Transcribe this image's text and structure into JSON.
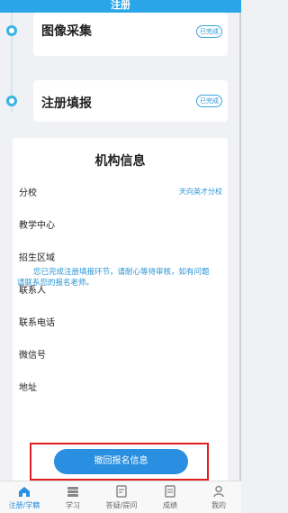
{
  "header": {
    "title": "注册"
  },
  "steps": [
    {
      "title": "图像采集",
      "status": "已完成"
    },
    {
      "title": "注册填报",
      "status": "已完成"
    }
  ],
  "info": {
    "title": "机构信息",
    "rows": [
      {
        "label": "分校",
        "value": "天向英才分校"
      },
      {
        "label": "教学中心",
        "value": ""
      },
      {
        "label": "招生区域",
        "value": ""
      },
      {
        "label": "联系人",
        "value": ""
      },
      {
        "label": "联系电话",
        "value": ""
      },
      {
        "label": "微信号",
        "value": ""
      },
      {
        "label": "地址",
        "value": ""
      }
    ],
    "notice": "您已完成注册填报环节，请耐心等待审核，如有问题请联系您的报名老师。"
  },
  "action": {
    "withdraw_label": "撤回报名信息"
  },
  "tabs": [
    {
      "label": "注册/学籍",
      "icon": "home-icon",
      "active": true
    },
    {
      "label": "学习",
      "icon": "study-icon",
      "active": false
    },
    {
      "label": "答疑/提问",
      "icon": "qa-icon",
      "active": false
    },
    {
      "label": "成绩",
      "icon": "grade-icon",
      "active": false
    },
    {
      "label": "我的",
      "icon": "profile-icon",
      "active": false
    }
  ],
  "colors": {
    "accent": "#2a8fe0",
    "header": "#2aa6e8",
    "highlight": "#e02020"
  }
}
